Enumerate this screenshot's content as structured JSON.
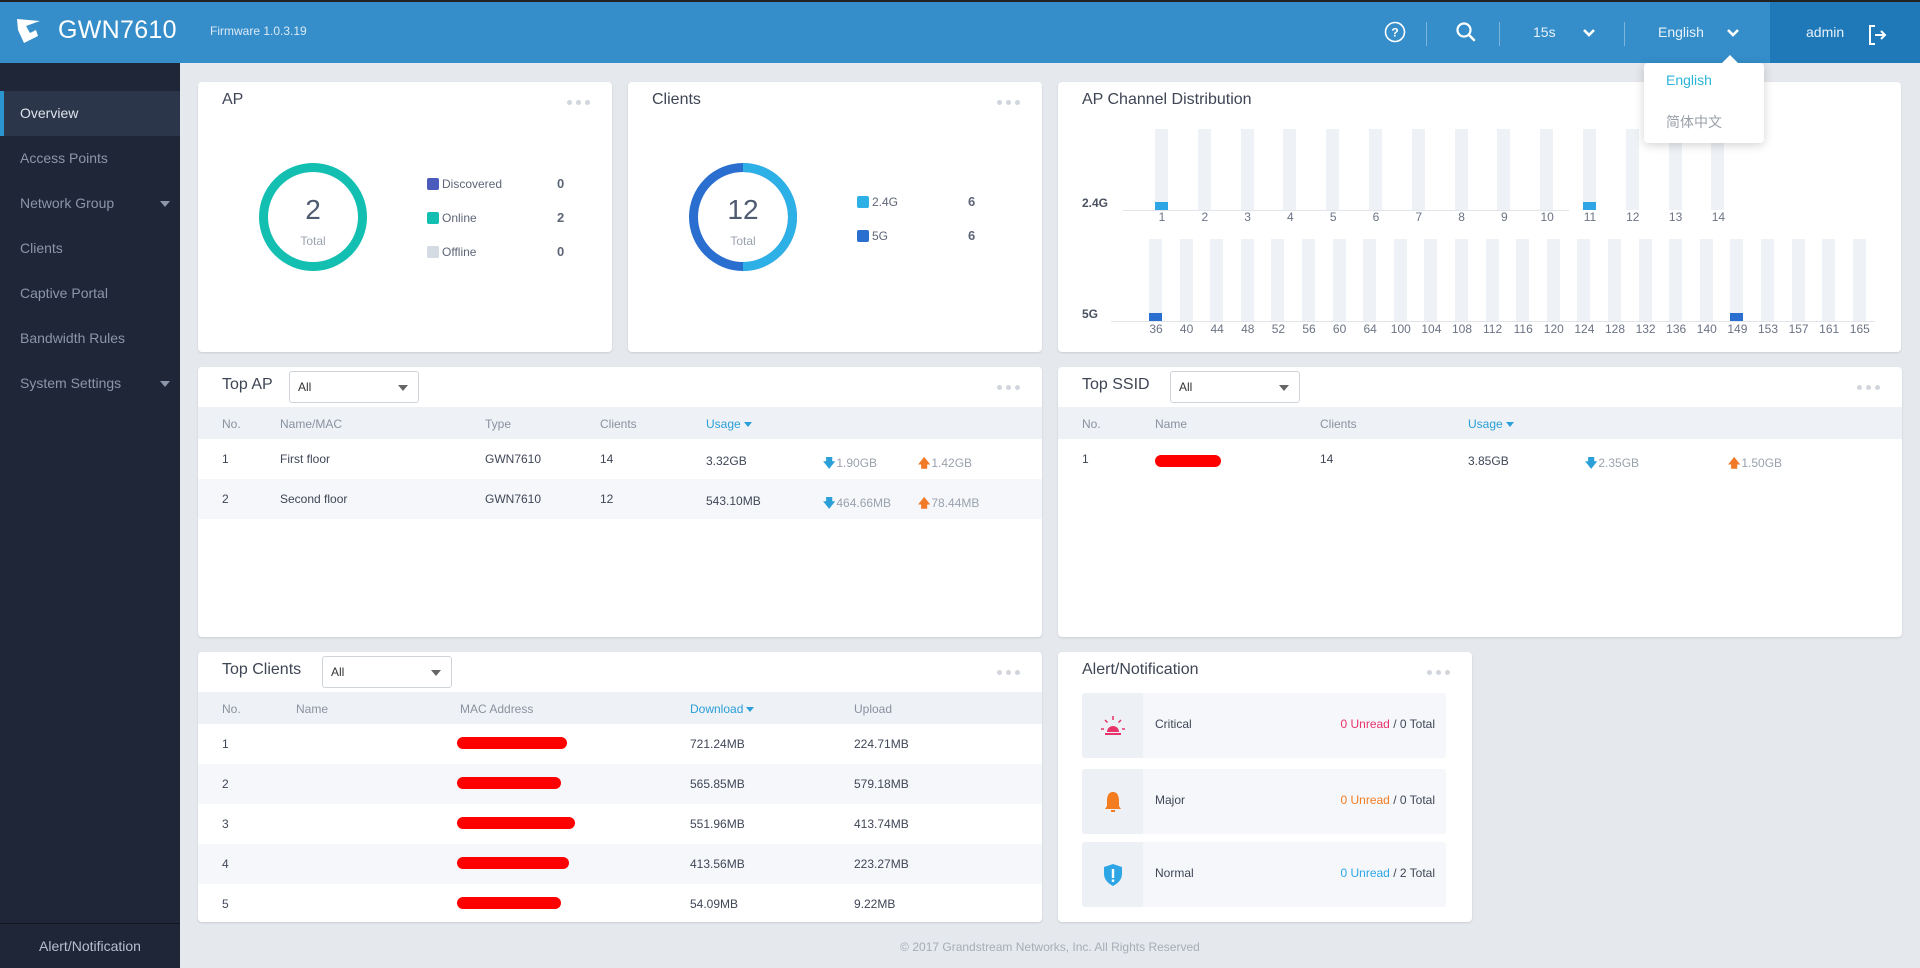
{
  "header": {
    "brand": "GWN7610",
    "firmware": "Firmware 1.0.3.19",
    "refresh_interval": "15s",
    "language": "English",
    "user": "admin",
    "icons": {
      "help": "help-circle-icon",
      "search": "search-icon",
      "logout": "logout-icon"
    }
  },
  "language_menu": {
    "options": [
      "English",
      "简体中文"
    ],
    "selected": "English"
  },
  "sidebar": {
    "items": [
      {
        "label": "Overview",
        "active": true
      },
      {
        "label": "Access Points"
      },
      {
        "label": "Network Group",
        "expandable": true
      },
      {
        "label": "Clients"
      },
      {
        "label": "Captive Portal"
      },
      {
        "label": "Bandwidth Rules"
      },
      {
        "label": "System Settings",
        "expandable": true
      }
    ],
    "footer": "Alert/Notification"
  },
  "ap_card": {
    "title": "AP",
    "total": "2",
    "total_label": "Total",
    "legend": [
      {
        "label": "Discovered",
        "value": "0",
        "color": "#4a5bbd"
      },
      {
        "label": "Online",
        "value": "2",
        "color": "#13bfb1"
      },
      {
        "label": "Offline",
        "value": "0",
        "color": "#d4dbe3"
      }
    ]
  },
  "clients_card": {
    "title": "Clients",
    "total": "12",
    "total_label": "Total",
    "legend": [
      {
        "label": "2.4G",
        "value": "6",
        "color": "#2db0e6"
      },
      {
        "label": "5G",
        "value": "6",
        "color": "#2a6fcf"
      }
    ]
  },
  "channel_card": {
    "title": "AP Channel Distribution",
    "band_24": {
      "label": "2.4G",
      "color": "#2ea6e6",
      "channels": [
        "1",
        "2",
        "3",
        "4",
        "5",
        "6",
        "7",
        "8",
        "9",
        "10",
        "11",
        "12",
        "13",
        "14"
      ],
      "counts": [
        1,
        0,
        0,
        0,
        0,
        0,
        0,
        0,
        0,
        0,
        1,
        0,
        0,
        0
      ]
    },
    "band_5": {
      "label": "5G",
      "color": "#2a6fcf",
      "channels": [
        "36",
        "40",
        "44",
        "48",
        "52",
        "56",
        "60",
        "64",
        "100",
        "104",
        "108",
        "112",
        "116",
        "120",
        "124",
        "128",
        "132",
        "136",
        "140",
        "149",
        "153",
        "157",
        "161",
        "165"
      ],
      "counts": [
        1,
        0,
        0,
        0,
        0,
        0,
        0,
        0,
        0,
        0,
        0,
        0,
        0,
        0,
        0,
        0,
        0,
        0,
        0,
        1,
        0,
        0,
        0,
        0
      ]
    },
    "max_count": 10
  },
  "top_ap": {
    "title": "Top AP",
    "filter": "All",
    "columns": [
      "No.",
      "Name/MAC",
      "Type",
      "Clients",
      "Usage"
    ],
    "rows": [
      {
        "no": "1",
        "name": "First floor",
        "type": "GWN7610",
        "clients": "14",
        "usage": "3.32GB",
        "down": "1.90GB",
        "up": "1.42GB"
      },
      {
        "no": "2",
        "name": "Second floor",
        "type": "GWN7610",
        "clients": "12",
        "usage": "543.10MB",
        "down": "464.66MB",
        "up": "78.44MB"
      }
    ]
  },
  "top_ssid": {
    "title": "Top SSID",
    "filter": "All",
    "columns": [
      "No.",
      "Name",
      "Clients",
      "Usage"
    ],
    "rows": [
      {
        "no": "1",
        "name": "[redacted]",
        "clients": "14",
        "usage": "3.85GB",
        "down": "2.35GB",
        "up": "1.50GB"
      }
    ]
  },
  "top_clients": {
    "title": "Top Clients",
    "filter": "All",
    "columns": [
      "No.",
      "Name",
      "MAC Address",
      "Download",
      "Upload"
    ],
    "rows": [
      {
        "no": "1",
        "name": "",
        "mac": "[redacted]",
        "download": "721.24MB",
        "upload": "224.71MB"
      },
      {
        "no": "2",
        "name": "",
        "mac": "[redacted]",
        "download": "565.85MB",
        "upload": "579.18MB"
      },
      {
        "no": "3",
        "name": "",
        "mac": "[redacted]",
        "download": "551.96MB",
        "upload": "413.74MB"
      },
      {
        "no": "4",
        "name": "",
        "mac": "[redacted]",
        "download": "413.56MB",
        "upload": "223.27MB"
      },
      {
        "no": "5",
        "name": "",
        "mac": "[redacted]",
        "download": "54.09MB",
        "upload": "9.22MB"
      }
    ]
  },
  "alerts": {
    "title": "Alert/Notification",
    "items": [
      {
        "name": "Critical",
        "unread": "0 Unread",
        "total": " / 0 Total",
        "color": "#e8336a",
        "icon": "siren-icon"
      },
      {
        "name": "Major",
        "unread": "0 Unread",
        "total": " / 0 Total",
        "color": "#f47c20",
        "icon": "bell-icon"
      },
      {
        "name": "Normal",
        "unread": "0 Unread",
        "total": " / 2 Total",
        "color": "#2ea6e6",
        "icon": "shield-alert-icon"
      }
    ]
  },
  "footer": "© 2017 Grandstream Networks, Inc. All Rights Reserved"
}
